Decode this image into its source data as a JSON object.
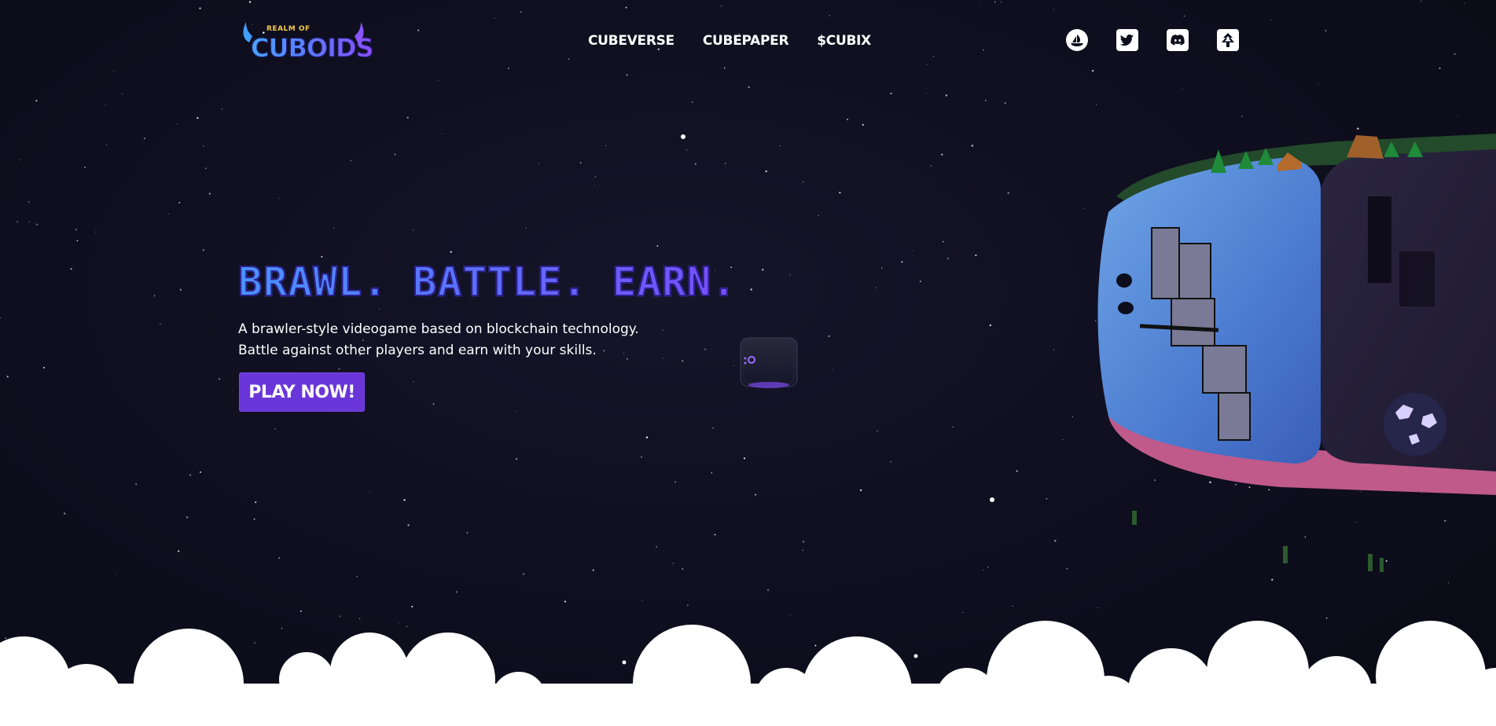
{
  "header": {
    "logo": {
      "small_text": "REALM OF",
      "big_text": "CUBOIDS"
    },
    "nav": [
      {
        "label": "CUBEVERSE"
      },
      {
        "label": "CUBEPAPER"
      },
      {
        "label": "$CUBIX"
      }
    ],
    "socials": [
      {
        "icon": "opensea-icon"
      },
      {
        "icon": "twitter-icon"
      },
      {
        "icon": "discord-icon"
      },
      {
        "icon": "linktree-icon"
      }
    ]
  },
  "hero": {
    "title": "BRAWL. BATTLE. EARN.",
    "description_line1": "A brawler-style videogame based on blockchain technology.",
    "description_line2": "Battle against other players and earn with your skills.",
    "cta_label": "PLAY NOW!"
  },
  "colors": {
    "background": "#0d0d1c",
    "accent": "#6a35d9",
    "title_gradient_start": "#4a92ff",
    "title_gradient_end": "#7a4dff",
    "text": "#ffffff"
  }
}
